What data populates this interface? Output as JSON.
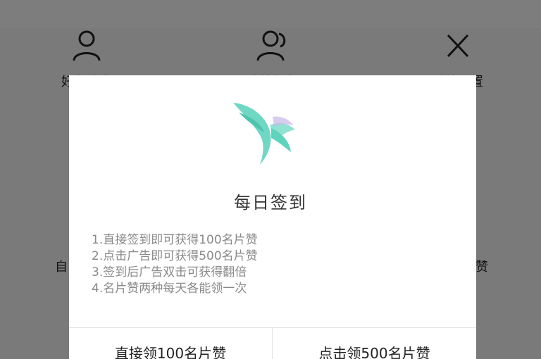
{
  "background": {
    "nav": [
      {
        "label": "好友动态",
        "icon": "person-icon"
      },
      {
        "label": "我的好友",
        "icon": "friends-icon"
      },
      {
        "label": "系统设置",
        "icon": "close-icon"
      }
    ],
    "side_left": "自",
    "side_right": "赞"
  },
  "dialog": {
    "logo_icon": "bird-logo-icon",
    "title": "每日签到",
    "rules": [
      "1.直接签到即可获得100名片赞",
      "2.点击广告即可获得500名片赞",
      "3.签到后广告双击可获得翻倍",
      "4.名片赞两种每天各能领一次"
    ],
    "buttons": {
      "left": "直接领100名片赞",
      "right": "点击领500名片赞"
    }
  },
  "colors": {
    "logo_teal": "#5fd3bd",
    "overlay": "rgba(0,0,0,0.5)"
  }
}
